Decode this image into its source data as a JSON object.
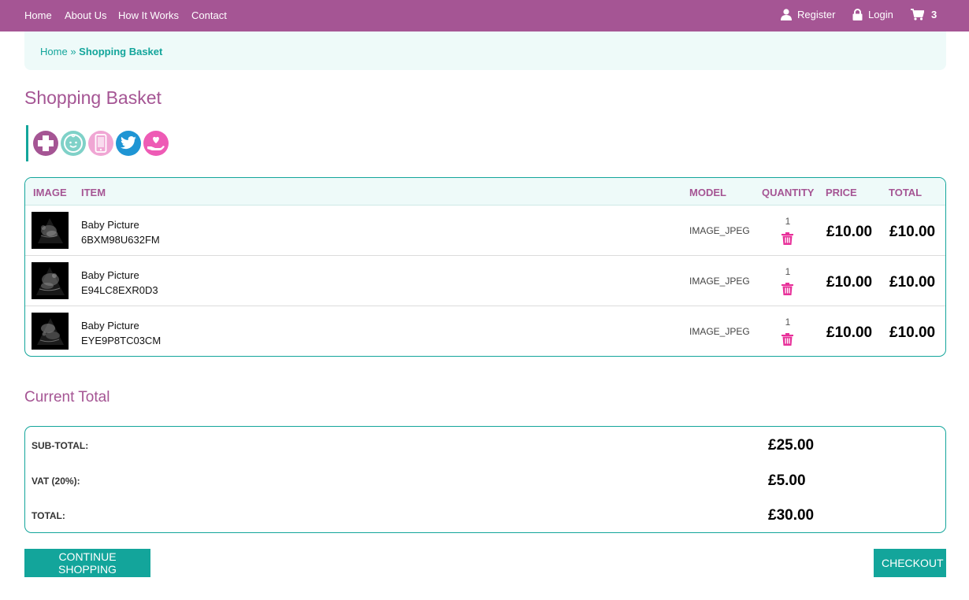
{
  "nav": {
    "home": "Home",
    "about": "About Us",
    "how": "How It Works",
    "contact": "Contact",
    "register": "Register",
    "login": "Login",
    "cart_count": "3"
  },
  "breadcrumb": {
    "home": "Home",
    "separator": "»",
    "current": "Shopping Basket"
  },
  "page_title": "Shopping Basket",
  "social_icons": [
    "medical-cross-icon",
    "baby-face-icon",
    "mobile-phone-icon",
    "twitter-icon",
    "heart-hand-icon"
  ],
  "basket": {
    "headers": {
      "image": "IMAGE",
      "item": "ITEM",
      "model": "MODEL",
      "quantity": "QUANTITY",
      "price": "PRICE",
      "total": "TOTAL"
    },
    "rows": [
      {
        "name": "Baby Picture",
        "code": "6BXM98U632FM",
        "model": "IMAGE_JPEG",
        "qty": "1",
        "price": "£10.00",
        "total": "£10.00"
      },
      {
        "name": "Baby Picture",
        "code": "E94LC8EXR0D3",
        "model": "IMAGE_JPEG",
        "qty": "1",
        "price": "£10.00",
        "total": "£10.00"
      },
      {
        "name": "Baby Picture",
        "code": "EYE9P8TC03CM",
        "model": "IMAGE_JPEG",
        "qty": "1",
        "price": "£10.00",
        "total": "£10.00"
      }
    ]
  },
  "current_total": {
    "title": "Current Total",
    "subtotal_label": "SUB-TOTAL:",
    "subtotal": "£25.00",
    "vat_label": "VAT (20%):",
    "vat": "£5.00",
    "total_label": "TOTAL:",
    "total": "£30.00"
  },
  "buttons": {
    "continue": "CONTINUE SHOPPING",
    "checkout": "CHECKOUT"
  },
  "colors": {
    "brand": "#a55594",
    "accent": "#13a59b",
    "pink": "#e8319a"
  }
}
